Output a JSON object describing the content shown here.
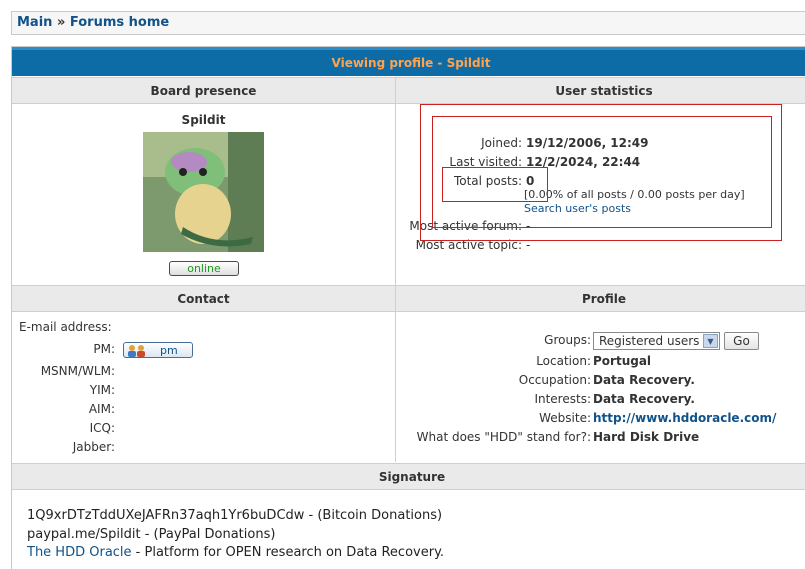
{
  "breadcrumb": {
    "main": "Main",
    "separator": "»",
    "forums_home": "Forums home"
  },
  "title": "Viewing profile - Spildit",
  "headers": {
    "board_presence": "Board presence",
    "user_statistics": "User statistics",
    "contact": "Contact",
    "profile": "Profile",
    "signature": "Signature"
  },
  "presence": {
    "username": "Spildit",
    "status": "online"
  },
  "stats": {
    "joined_label": "Joined:",
    "joined_value": "19/12/2006, 12:49",
    "last_visited_label": "Last visited:",
    "last_visited_value": "12/2/2024, 22:44",
    "total_posts_label": "Total posts:",
    "total_posts_value": "0",
    "posts_detail": "[0.00% of all posts / 0.00 posts per day]",
    "search_link": "Search user's posts",
    "most_active_forum_label": "Most active forum:",
    "most_active_forum_value": "-",
    "most_active_topic_label": "Most active topic:",
    "most_active_topic_value": "-"
  },
  "contact": {
    "email_label": "E-mail address:",
    "pm_label": "PM:",
    "pm_button": "pm",
    "msnm_label": "MSNM/WLM:",
    "yim_label": "YIM:",
    "aim_label": "AIM:",
    "icq_label": "ICQ:",
    "jabber_label": "Jabber:"
  },
  "profile": {
    "groups_label": "Groups:",
    "groups_selected": "Registered users",
    "go_button": "Go",
    "location_label": "Location:",
    "location_value": "Portugal",
    "occupation_label": "Occupation:",
    "occupation_value": "Data Recovery.",
    "interests_label": "Interests:",
    "interests_value": "Data Recovery.",
    "website_label": "Website:",
    "website_value": "http://www.hddoracle.com/",
    "hdd_label": "What does \"HDD\" stand for?:",
    "hdd_value": "Hard Disk Drive"
  },
  "signature": {
    "line1": "1Q9xrDTzTddUXeJAFRn37aqh1Yr6buDCdw - (Bitcoin Donations)",
    "line2": "paypal.me/Spildit - (PayPal Donations)",
    "line3_link": "The HDD Oracle",
    "line3_rest": " - Platform for OPEN research on Data Recovery."
  },
  "colors": {
    "title_bar": "#0d6ba6",
    "title_text": "#ffa34f",
    "link": "#105289",
    "online": "#1f9a1f",
    "highlight_box": "#cc1f1f"
  }
}
